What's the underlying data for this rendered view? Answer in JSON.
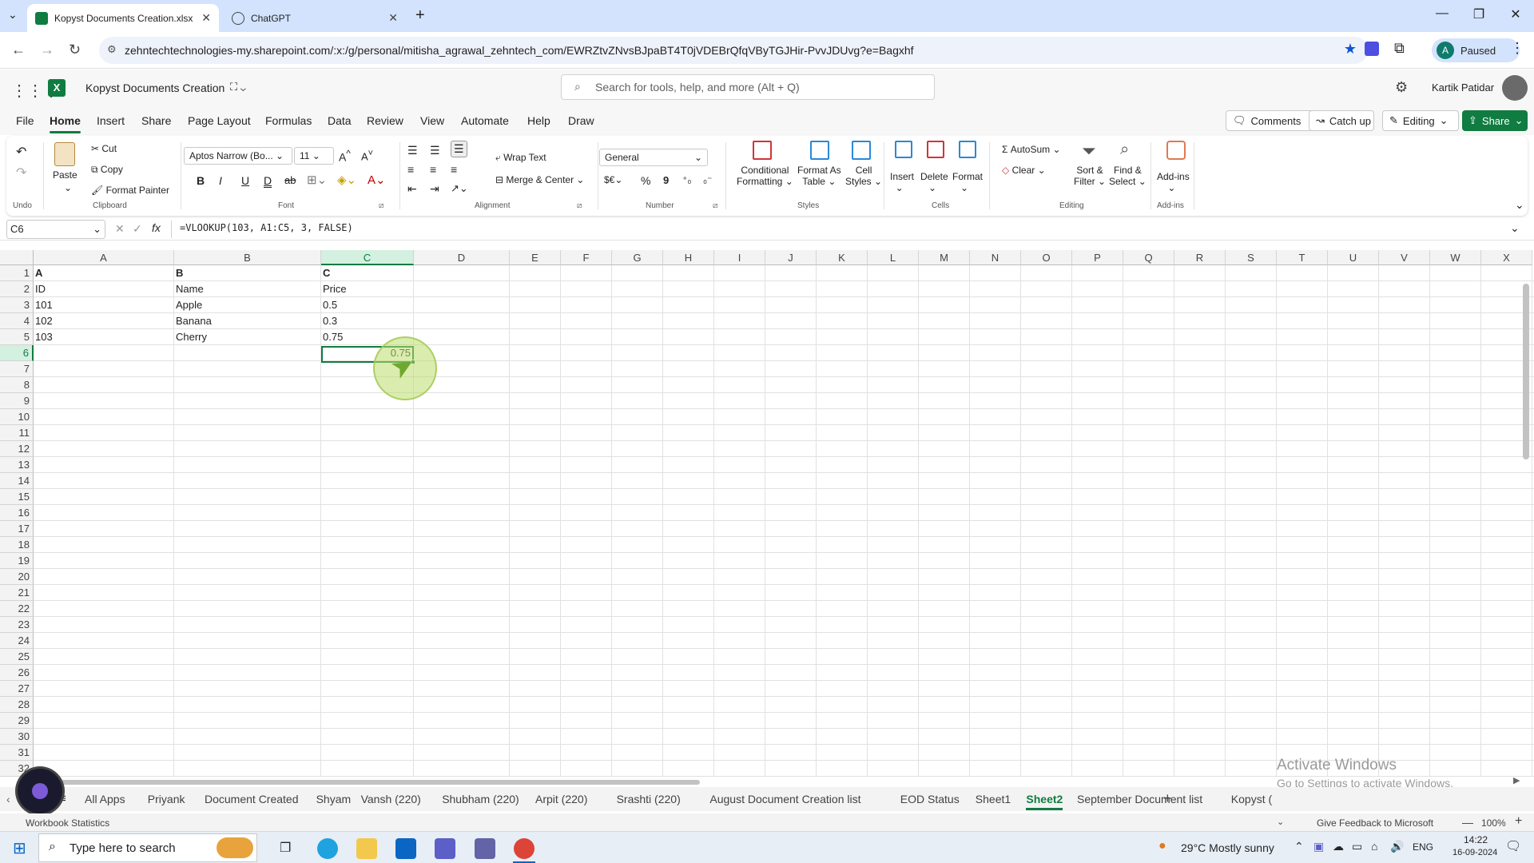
{
  "browser": {
    "tabs": [
      {
        "title": "Kopyst Documents Creation.xlsx",
        "active": true
      },
      {
        "title": "ChatGPT",
        "active": false
      }
    ],
    "new_tab": "+",
    "url": "zehntechtechnologies-my.sharepoint.com/:x:/g/personal/mitisha_agrawal_zehntech_com/EWRZtvZNvsBJpaBT4T0jVDEBrQfqVByTGJHir-PvvJDUvg?e=Bagxhf",
    "profile_label": "Paused",
    "profile_initial": "A"
  },
  "excel": {
    "doc_title": "Kopyst Documents Creation",
    "search_placeholder": "Search for tools, help, and more (Alt + Q)",
    "user_name": "Kartik Patidar",
    "menu": [
      "File",
      "Home",
      "Insert",
      "Share",
      "Page Layout",
      "Formulas",
      "Data",
      "Review",
      "View",
      "Automate",
      "Help",
      "Draw"
    ],
    "active_menu": "Home",
    "comments_label": "Comments",
    "catchup_label": "Catch up",
    "editing_label": "Editing",
    "share_label": "Share"
  },
  "ribbon": {
    "undo_group": "Undo",
    "paste": "Paste",
    "cut": "Cut",
    "copy": "Copy",
    "format_painter": "Format Painter",
    "clipboard_group": "Clipboard",
    "font_name": "Aptos Narrow (Bo...",
    "font_size": "11",
    "bold": "B",
    "italic": "I",
    "underline": "U",
    "double_underline": "D",
    "strike": "ab",
    "font_group": "Font",
    "wrap_text": "Wrap Text",
    "merge_center": "Merge & Center",
    "alignment_group": "Alignment",
    "number_format": "General",
    "number_group": "Number",
    "currency": "$€",
    "percent": "%",
    "comma": "9",
    "conditional_formatting_1": "Conditional",
    "conditional_formatting_2": "Formatting",
    "format_as_table_1": "Format As",
    "format_as_table_2": "Table",
    "cell_styles_1": "Cell",
    "cell_styles_2": "Styles",
    "styles_group": "Styles",
    "insert": "Insert",
    "delete": "Delete",
    "format": "Format",
    "cells_group": "Cells",
    "autosum": "AutoSum",
    "clear": "Clear",
    "sort_filter_1": "Sort &",
    "sort_filter_2": "Filter",
    "find_select_1": "Find &",
    "find_select_2": "Select",
    "editing_group": "Editing",
    "addins": "Add-ins",
    "addins_group": "Add-ins"
  },
  "formula_bar": {
    "name_box": "C6",
    "formula": "=VLOOKUP(103, A1:C5, 3, FALSE)"
  },
  "grid": {
    "columns": [
      "A",
      "B",
      "C",
      "D",
      "E",
      "F",
      "G",
      "H",
      "I",
      "J",
      "K",
      "L",
      "M",
      "N",
      "O",
      "P",
      "Q",
      "R",
      "S",
      "T",
      "U",
      "V",
      "W",
      "X"
    ],
    "rows": [
      "1",
      "2",
      "3",
      "4",
      "5",
      "6",
      "7",
      "8",
      "9",
      "10",
      "11",
      "12",
      "13",
      "14",
      "15",
      "16",
      "17",
      "18",
      "19",
      "20",
      "21",
      "22",
      "23",
      "24",
      "25",
      "26",
      "27",
      "28",
      "29",
      "30",
      "31",
      "32"
    ],
    "selected_column": "C",
    "selected_row": "6",
    "cells": {
      "A1": "A",
      "B1": "B",
      "C1": "C",
      "A2": "ID",
      "B2": "Name",
      "C2": "Price",
      "A3": "101",
      "B3": "Apple",
      "C3": "0.5",
      "A4": "102",
      "B4": "Banana",
      "C4": "0.3",
      "A5": "103",
      "B5": "Cherry",
      "C5": "0.75",
      "C6": "0.75"
    }
  },
  "sheets": [
    "All Apps",
    "Priyank",
    "Document Created",
    "Shyam",
    "Vansh (220)",
    "Shubham (220)",
    "Arpit (220)",
    "Srashti (220)",
    "August Document Creation list",
    "EOD Status",
    "Sheet1",
    "Sheet2",
    "September Document list",
    "Kopyst ("
  ],
  "active_sheet": "Sheet2",
  "status": {
    "left": "Workbook Statistics",
    "feedback": "Give Feedback to Microsoft",
    "zoom": "100%"
  },
  "watermark": {
    "line1": "Activate Windows",
    "line2": "Go to Settings to activate Windows."
  },
  "taskbar": {
    "search_placeholder": "Type here to search",
    "weather": "29°C  Mostly sunny",
    "lang": "ENG",
    "time": "14:22",
    "date": "16-09-2024"
  },
  "colors": {
    "excel_green": "#107c41",
    "tab_bar": "#d3e3fd"
  }
}
